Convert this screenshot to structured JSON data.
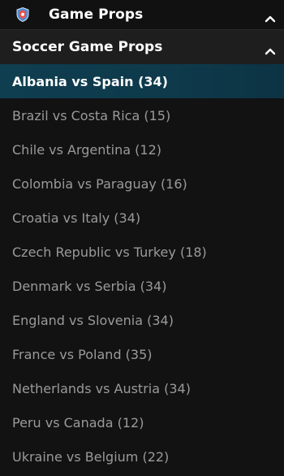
{
  "header": {
    "title": "Game Props",
    "icon": "shield-icon",
    "accent": "#4a8fd6"
  },
  "subheader": {
    "title": "Soccer Game Props"
  },
  "matches": [
    {
      "label": "Albania vs Spain (34)",
      "active": true
    },
    {
      "label": "Brazil vs Costa Rica (15)",
      "active": false
    },
    {
      "label": "Chile vs Argentina (12)",
      "active": false
    },
    {
      "label": "Colombia vs Paraguay (16)",
      "active": false
    },
    {
      "label": "Croatia vs Italy (34)",
      "active": false
    },
    {
      "label": "Czech Republic vs Turkey (18)",
      "active": false
    },
    {
      "label": "Denmark vs Serbia (34)",
      "active": false
    },
    {
      "label": "England vs Slovenia (34)",
      "active": false
    },
    {
      "label": "France vs Poland (35)",
      "active": false
    },
    {
      "label": "Netherlands vs Austria (34)",
      "active": false
    },
    {
      "label": "Peru vs Canada (12)",
      "active": false
    },
    {
      "label": "Ukraine vs Belgium (22)",
      "active": false
    }
  ]
}
